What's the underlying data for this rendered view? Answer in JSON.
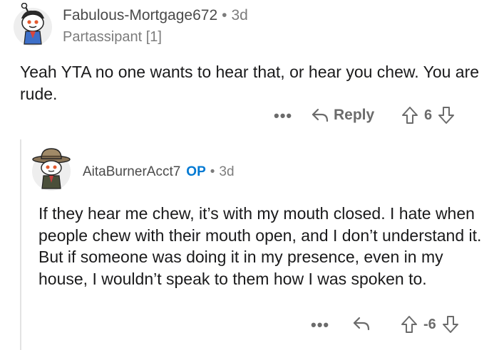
{
  "comment1": {
    "username": "Fabulous-Mortgage672",
    "separator": "•",
    "time": "3d",
    "flair": "Partassipant [1]",
    "body": "Yeah YTA no one wants to hear that, or hear you chew. You are rude.",
    "more_label": "•••",
    "reply_label": "Reply",
    "score": "6"
  },
  "comment2": {
    "username": "AitaBurnerAcct7",
    "op_badge": "OP",
    "separator": "•",
    "time": "3d",
    "body": "If they hear me chew, it’s with my mouth closed. I hate when people chew with their mouth open, and I don’t understand it. But if someone was doing it in my presence, even in my house, I wouldn’t speak to them how I was spoken to.",
    "more_label": "•••",
    "score": "-6"
  },
  "colors": {
    "op_blue": "#0079d3",
    "meta_gray": "#7c7c7c",
    "icon_gray": "#6b6b6b"
  },
  "icons": {
    "reply": "reply-arrow-icon",
    "upvote": "upvote-arrow-icon",
    "downvote": "downvote-arrow-icon",
    "more": "more-options-icon"
  }
}
